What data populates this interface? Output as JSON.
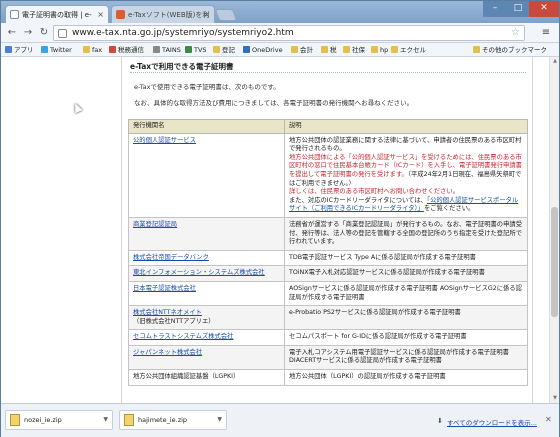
{
  "browser": {
    "tabs": [
      {
        "label": "電子証明書の取得 | e-",
        "active": true
      },
      {
        "label": "e-Taxソフト(WEB版)を利",
        "active": false
      }
    ],
    "url": "www.e-tax.nta.go.jp/systemriyo/systemriyo2.htm",
    "bookmarks": [
      "アプリ",
      "Twitter",
      "fax",
      "税務通信",
      "TAINS",
      "TVS",
      "登記",
      "OneDrive",
      "会計",
      "税",
      "社保",
      "hp",
      "エクセル"
    ],
    "other_bookmarks": "その他のブックマーク"
  },
  "page": {
    "heading": "e-Taxで利用できる電子証明書",
    "intro1": "e-Taxで使用できる電子証明書は、次のものです。",
    "intro2": "なお、具体的な取得方法及び費用につきましては、各電子証明書の発行機関へお尋ねください。",
    "table": {
      "headers": [
        "発行機関名",
        "説明"
      ],
      "rows": [
        {
          "issuer": "公的個人認証サービス",
          "desc_normal1": "地方公共団体の認証業務に関する法律に基づいて、申請者の住民票のある市区町村で発行されるもの。",
          "desc_red1": "地方公共団体による「公的個人認証サービス」を受けるためには、住民票のある市区町村の窓口で住民基本台帳カード（ICカード）を入手し、電子証明書発行申請書を提出して電子証明書の発行を受けます。",
          "desc_normal2": "（平成24年2月1日現在、福島県矢祭町ではご利用できません。）",
          "desc_red2": "詳しくは、住民票のある市区町村へお問い合わせください。",
          "desc_normal3": "また、対応のICカードリーダライタについては、",
          "desc_link": "「公的個人認証サービスポータルサイト（ご利用できるICカードリーダライタ）」",
          "desc_normal4": "をご覧ください。"
        },
        {
          "issuer": "商業登記認証局",
          "desc": "法務省が運営する「商業登記認証局」が発行するもの。なお、電子証明書の申請受付、発行等は、法人等の登記を管轄する全国の登記所のうち指定を受けた登記所で行われています。"
        },
        {
          "issuer": "株式会社帝国データバンク",
          "desc": "TDB電子認証サービス Type Aに係る認証局が作成する電子証明書"
        },
        {
          "issuer": "東北インフォメーション・システムズ株式会社",
          "desc": "TOiNX電子入札対応認証サービスに係る認証局が作成する電子証明書"
        },
        {
          "issuer": "日本電子認証株式会社",
          "desc": "AOSignサービスに係る認証局が作成する電子証明書 AOSignサービスG2に係る認証局が作成する電子証明書"
        },
        {
          "issuer": "株式会社NTTネオメイト",
          "issuer_note": "（旧株式会社NTTアプリエ）",
          "desc": "e-Probatio PS2サービスに係る認証局が作成する電子証明書"
        },
        {
          "issuer": "セコムトラストシステムズ株式会社",
          "desc": "セコムパスポート for G-IDに係る認証局が作成する電子証明書"
        },
        {
          "issuer": "ジャパンネット株式会社",
          "desc": "電子入札コアシステム用電子認証サービスに係る認証局が作成する電子証明書 DIACERTサービスに係る認証局が作成する電子証明書"
        },
        {
          "issuer": "地方公共団体組織認証基盤（LGPKI）",
          "desc": "地方公共団体（LGPKI）の認証局が作成する電子証明書"
        }
      ]
    }
  },
  "downloads": {
    "items": [
      "nozei_ie.zip",
      "hajimete_ie.zip"
    ],
    "show_all": "すべてのダウンロードを表示..."
  }
}
